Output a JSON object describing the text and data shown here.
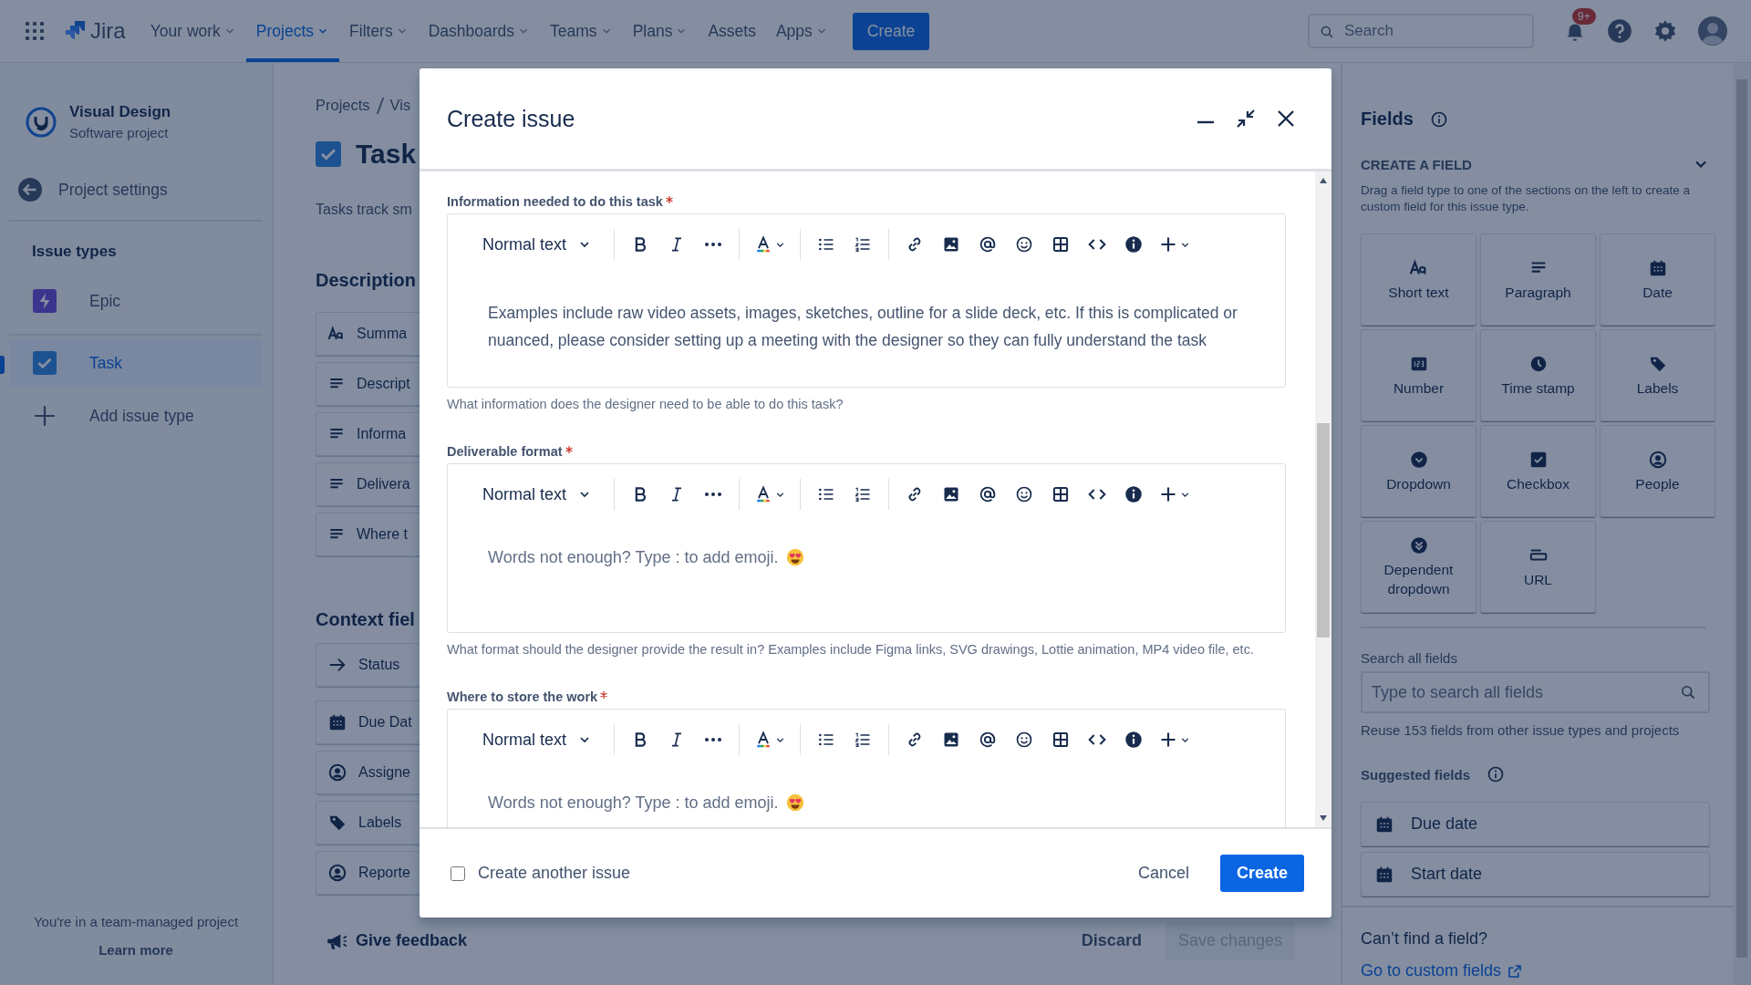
{
  "top_nav": {
    "product": "Jira",
    "items": [
      {
        "label": "Your work",
        "dropdown": true,
        "selected": false
      },
      {
        "label": "Projects",
        "dropdown": true,
        "selected": true
      },
      {
        "label": "Filters",
        "dropdown": true,
        "selected": false
      },
      {
        "label": "Dashboards",
        "dropdown": true,
        "selected": false
      },
      {
        "label": "Teams",
        "dropdown": true,
        "selected": false
      },
      {
        "label": "Plans",
        "dropdown": true,
        "selected": false
      },
      {
        "label": "Assets",
        "dropdown": false,
        "selected": false
      },
      {
        "label": "Apps",
        "dropdown": true,
        "selected": false
      }
    ],
    "create_button": "Create",
    "search": {
      "placeholder": "Search"
    },
    "notification_badge": "9+"
  },
  "sidebar": {
    "project_name": "Visual Design",
    "project_type": "Software project",
    "back_link": "Project settings",
    "section_title": "Issue types",
    "issue_types": [
      {
        "label": "Epic",
        "kind": "epic",
        "selected": false
      },
      {
        "label": "Task",
        "kind": "task",
        "selected": true
      }
    ],
    "add_link": "Add issue type",
    "footer_text": "You're in a team-managed project",
    "footer_link": "Learn more"
  },
  "main": {
    "breadcrumbs": [
      "Projects",
      "Vis"
    ],
    "title": "Task",
    "subtitle": "Tasks track sm",
    "description_heading": "Description",
    "description_fields": [
      {
        "label": "Summa",
        "kind": "short_text"
      },
      {
        "label": "Descript",
        "kind": "paragraph"
      },
      {
        "label": "Informa",
        "kind": "paragraph"
      },
      {
        "label": "Delivera",
        "kind": "paragraph"
      },
      {
        "label": "Where t",
        "kind": "paragraph"
      }
    ],
    "context_heading": "Context fiel",
    "context_fields": [
      {
        "label": "Status",
        "kind": "status"
      },
      {
        "label": "Due Dat",
        "kind": "date"
      },
      {
        "label": "Assigne",
        "kind": "people"
      },
      {
        "label": "Labels",
        "kind": "labels"
      },
      {
        "label": "Reporte",
        "kind": "people"
      }
    ],
    "feedback": "Give feedback",
    "discard": "Discard",
    "save": {
      "label": "Save changes",
      "disabled": true
    }
  },
  "fields_panel": {
    "title": "Fields",
    "create_heading": "CREATE A FIELD",
    "expanded": true,
    "create_hint": "Drag a field type to one of the sections on the left to create a custom field for this issue type.",
    "field_types": [
      {
        "label": "Short text",
        "kind": "short_text"
      },
      {
        "label": "Paragraph",
        "kind": "paragraph"
      },
      {
        "label": "Date",
        "kind": "date"
      },
      {
        "label": "Number",
        "kind": "number"
      },
      {
        "label": "Time stamp",
        "kind": "time"
      },
      {
        "label": "Labels",
        "kind": "labels"
      },
      {
        "label": "Dropdown",
        "kind": "dropdown"
      },
      {
        "label": "Checkbox",
        "kind": "checkbox"
      },
      {
        "label": "People",
        "kind": "people"
      },
      {
        "label": "Dependent dropdown",
        "kind": "dependent"
      },
      {
        "label": "URL",
        "kind": "url"
      }
    ],
    "search_label": "Search all fields",
    "search": {
      "placeholder": "Type to search all fields"
    },
    "search_hint": "Reuse 153 fields from other issue types and projects",
    "suggested_heading": "Suggested fields",
    "suggested": [
      {
        "label": "Due date",
        "kind": "date"
      },
      {
        "label": "Start date",
        "kind": "date"
      }
    ],
    "missing_text": "Can’t find a field?",
    "custom_link": "Go to custom fields"
  },
  "modal": {
    "title": "Create issue",
    "fields": [
      {
        "label": "Information needed to do this task",
        "required": true,
        "text_style": "Normal text",
        "value": "Examples include raw video assets, images, sketches, outline for a slide deck, etc. If this is complicated or nuanced, please consider setting up a meeting with the designer so they can fully understand the task",
        "helper": "What information does the designer need to be able to do this task?"
      },
      {
        "label": "Deliverable format",
        "required": true,
        "text_style": "Normal text",
        "placeholder": "Words not enough? Type : to add emoji.",
        "helper": "What format should the designer provide the result in? Examples include Figma links, SVG drawings, Lottie animation, MP4 video file, etc."
      },
      {
        "label": "Where to store the work",
        "required": true,
        "text_style": "Normal text",
        "placeholder": "Words not enough? Type : to add emoji."
      }
    ],
    "create_another": {
      "label": "Create another issue",
      "checked": false
    },
    "cancel": "Cancel",
    "submit": "Create"
  }
}
